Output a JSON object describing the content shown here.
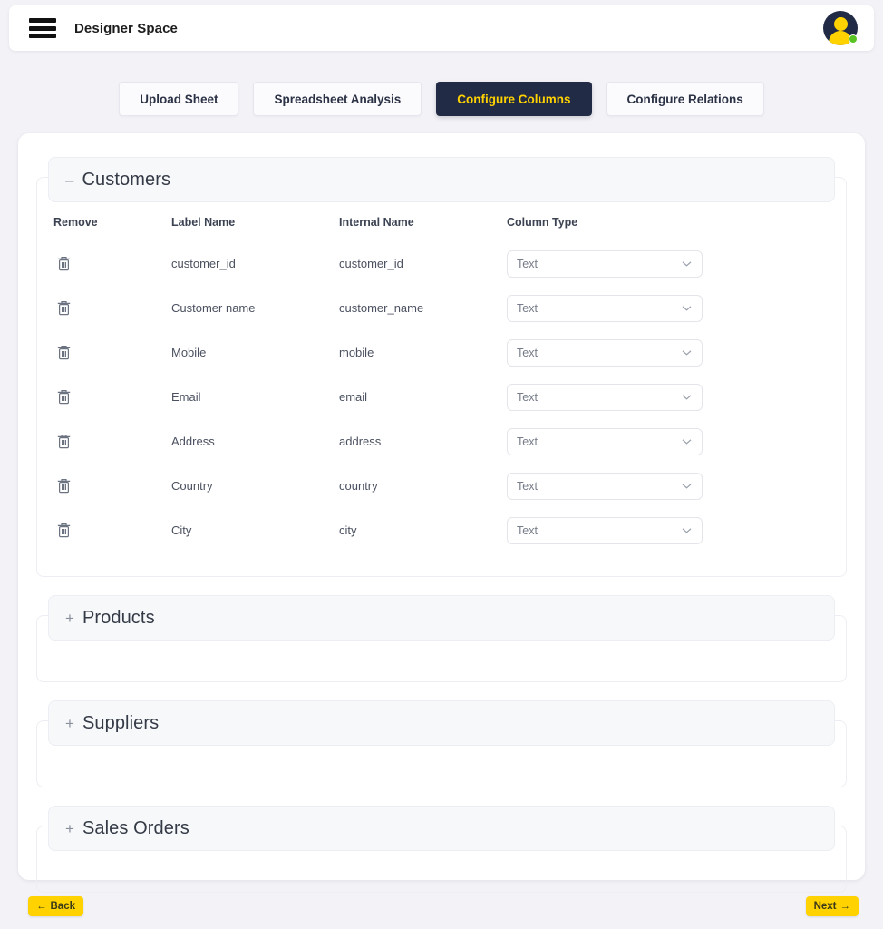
{
  "header": {
    "menu_icon": "hamburger-icon",
    "title": "Designer Space",
    "avatar_icon": "user-avatar-icon",
    "status": "online"
  },
  "tabs": [
    {
      "label": "Upload Sheet",
      "active": false
    },
    {
      "label": "Spreadsheet Analysis",
      "active": false
    },
    {
      "label": "Configure Columns",
      "active": true
    },
    {
      "label": "Configure Relations",
      "active": false
    }
  ],
  "table_headers": {
    "remove": "Remove",
    "label_name": "Label Name",
    "internal_name": "Internal Name",
    "column_type": "Column Type"
  },
  "sections": [
    {
      "name": "Customers",
      "expanded": true,
      "toggle_sign": "–",
      "rows": [
        {
          "remove_icon": "trash-icon",
          "label_name": "customer_id",
          "internal_name": "customer_id",
          "column_type": "Text"
        },
        {
          "remove_icon": "trash-icon",
          "label_name": "Customer name",
          "internal_name": "customer_name",
          "column_type": "Text"
        },
        {
          "remove_icon": "trash-icon",
          "label_name": "Mobile",
          "internal_name": "mobile",
          "column_type": "Text"
        },
        {
          "remove_icon": "trash-icon",
          "label_name": "Email",
          "internal_name": "email",
          "column_type": "Text"
        },
        {
          "remove_icon": "trash-icon",
          "label_name": "Address",
          "internal_name": "address",
          "column_type": "Text"
        },
        {
          "remove_icon": "trash-icon",
          "label_name": "Country",
          "internal_name": "country",
          "column_type": "Text"
        },
        {
          "remove_icon": "trash-icon",
          "label_name": "City",
          "internal_name": "city",
          "column_type": "Text"
        }
      ]
    },
    {
      "name": "Products",
      "expanded": false,
      "toggle_sign": "+",
      "rows": []
    },
    {
      "name": "Suppliers",
      "expanded": false,
      "toggle_sign": "+",
      "rows": []
    },
    {
      "name": "Sales Orders",
      "expanded": false,
      "toggle_sign": "+",
      "rows": []
    }
  ],
  "footer": {
    "back_label": "Back",
    "back_icon": "arrow-left-icon",
    "next_label": "Next",
    "next_icon": "arrow-right-icon"
  },
  "colors": {
    "accent_yellow": "#ffd200",
    "navy": "#222b45",
    "page_bg": "#f2f2f7",
    "status_green": "#58c322"
  }
}
